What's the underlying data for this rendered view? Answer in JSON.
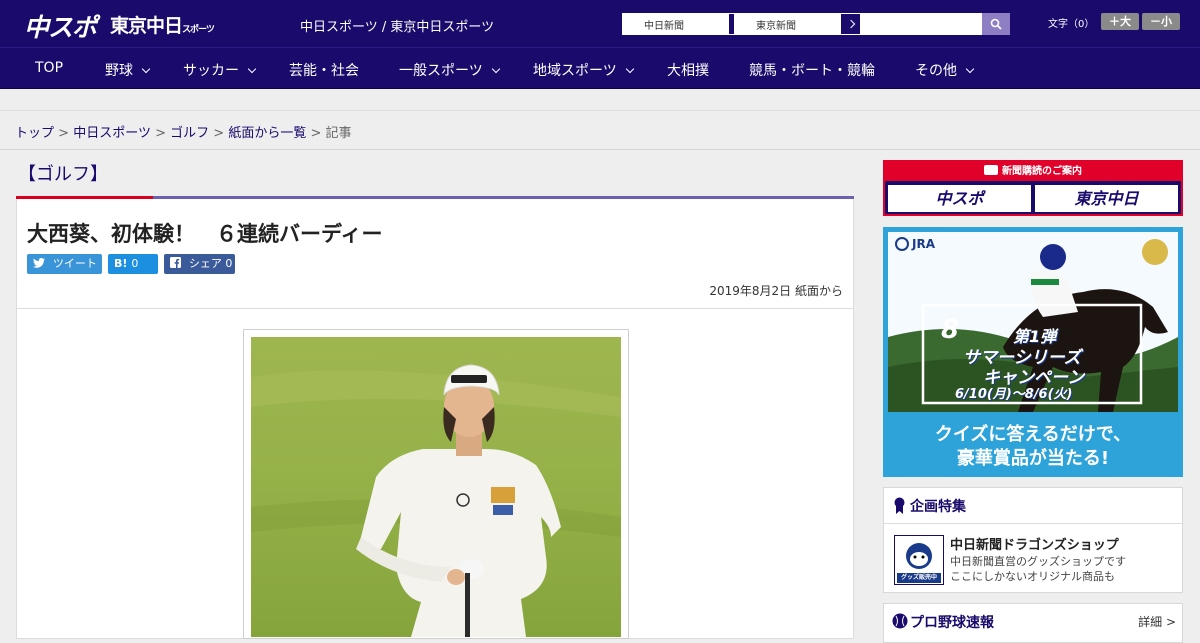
{
  "header": {
    "logo_main": "中スポ",
    "logo_sub": "東京中日",
    "logo_sub_small": "スポーツ",
    "site_title": "中日スポーツ / 東京中日スポーツ",
    "ext_links": [
      "中日新聞",
      "東京新聞"
    ],
    "search_placeholder": "",
    "fontsize_label": "文字（0）",
    "font_larger": "＋大",
    "font_smaller": "－小"
  },
  "nav": {
    "items": [
      {
        "label": "TOP",
        "dropdown": false
      },
      {
        "label": "野球",
        "dropdown": true
      },
      {
        "label": "サッカー",
        "dropdown": true
      },
      {
        "label": "芸能・社会",
        "dropdown": false
      },
      {
        "label": "一般スポーツ",
        "dropdown": true
      },
      {
        "label": "地域スポーツ",
        "dropdown": true
      },
      {
        "label": "大相撲",
        "dropdown": false
      },
      {
        "label": "競馬・ボート・競輪",
        "dropdown": false
      },
      {
        "label": "その他",
        "dropdown": true
      }
    ]
  },
  "breadcrumb": {
    "items": [
      "トップ",
      "中日スポーツ",
      "ゴルフ",
      "紙面から一覧"
    ],
    "current": "記事",
    "separator": ">"
  },
  "article": {
    "category": "【ゴルフ】",
    "headline": "大西葵、初体験！　６連続バーディー",
    "share": {
      "tweet_label": "ツイート",
      "hatena_icon": "B!",
      "hatena_count": "0",
      "facebook_label": "シェア",
      "facebook_count": "0"
    },
    "date": "2019年8月2日 紙面から",
    "photo_alt": "golfer crouching on green"
  },
  "sidebar": {
    "promo": {
      "head": "新聞購読のご案内",
      "logos": [
        "中スポ",
        "東京中日"
      ]
    },
    "ad": {
      "brand": "JRA",
      "number": "8",
      "campaign_no": "第1弾",
      "campaign_title_1": "サマーシリーズ",
      "campaign_title_2": "キャンペーン",
      "campaign_dates": "6/10(月)～8/6(火)",
      "tagline_1": "クイズに答えるだけで、",
      "tagline_2": "豪華賞品が当たる!"
    },
    "feature": {
      "heading": "企画特集",
      "shop_title": "中日新聞ドラゴンズショップ",
      "shop_desc_1": "中日新聞直営のグッズショップです",
      "shop_desc_2": "ここにしかないオリジナル商品も",
      "shop_thumb_text": "グッズ販売中"
    },
    "baseball": {
      "heading": "プロ野球速報",
      "detail_link": "詳細 >"
    }
  },
  "colors": {
    "brand_navy": "#1a0a6b",
    "accent_red": "#d8001d",
    "accent_purple": "#6d5fb2"
  }
}
